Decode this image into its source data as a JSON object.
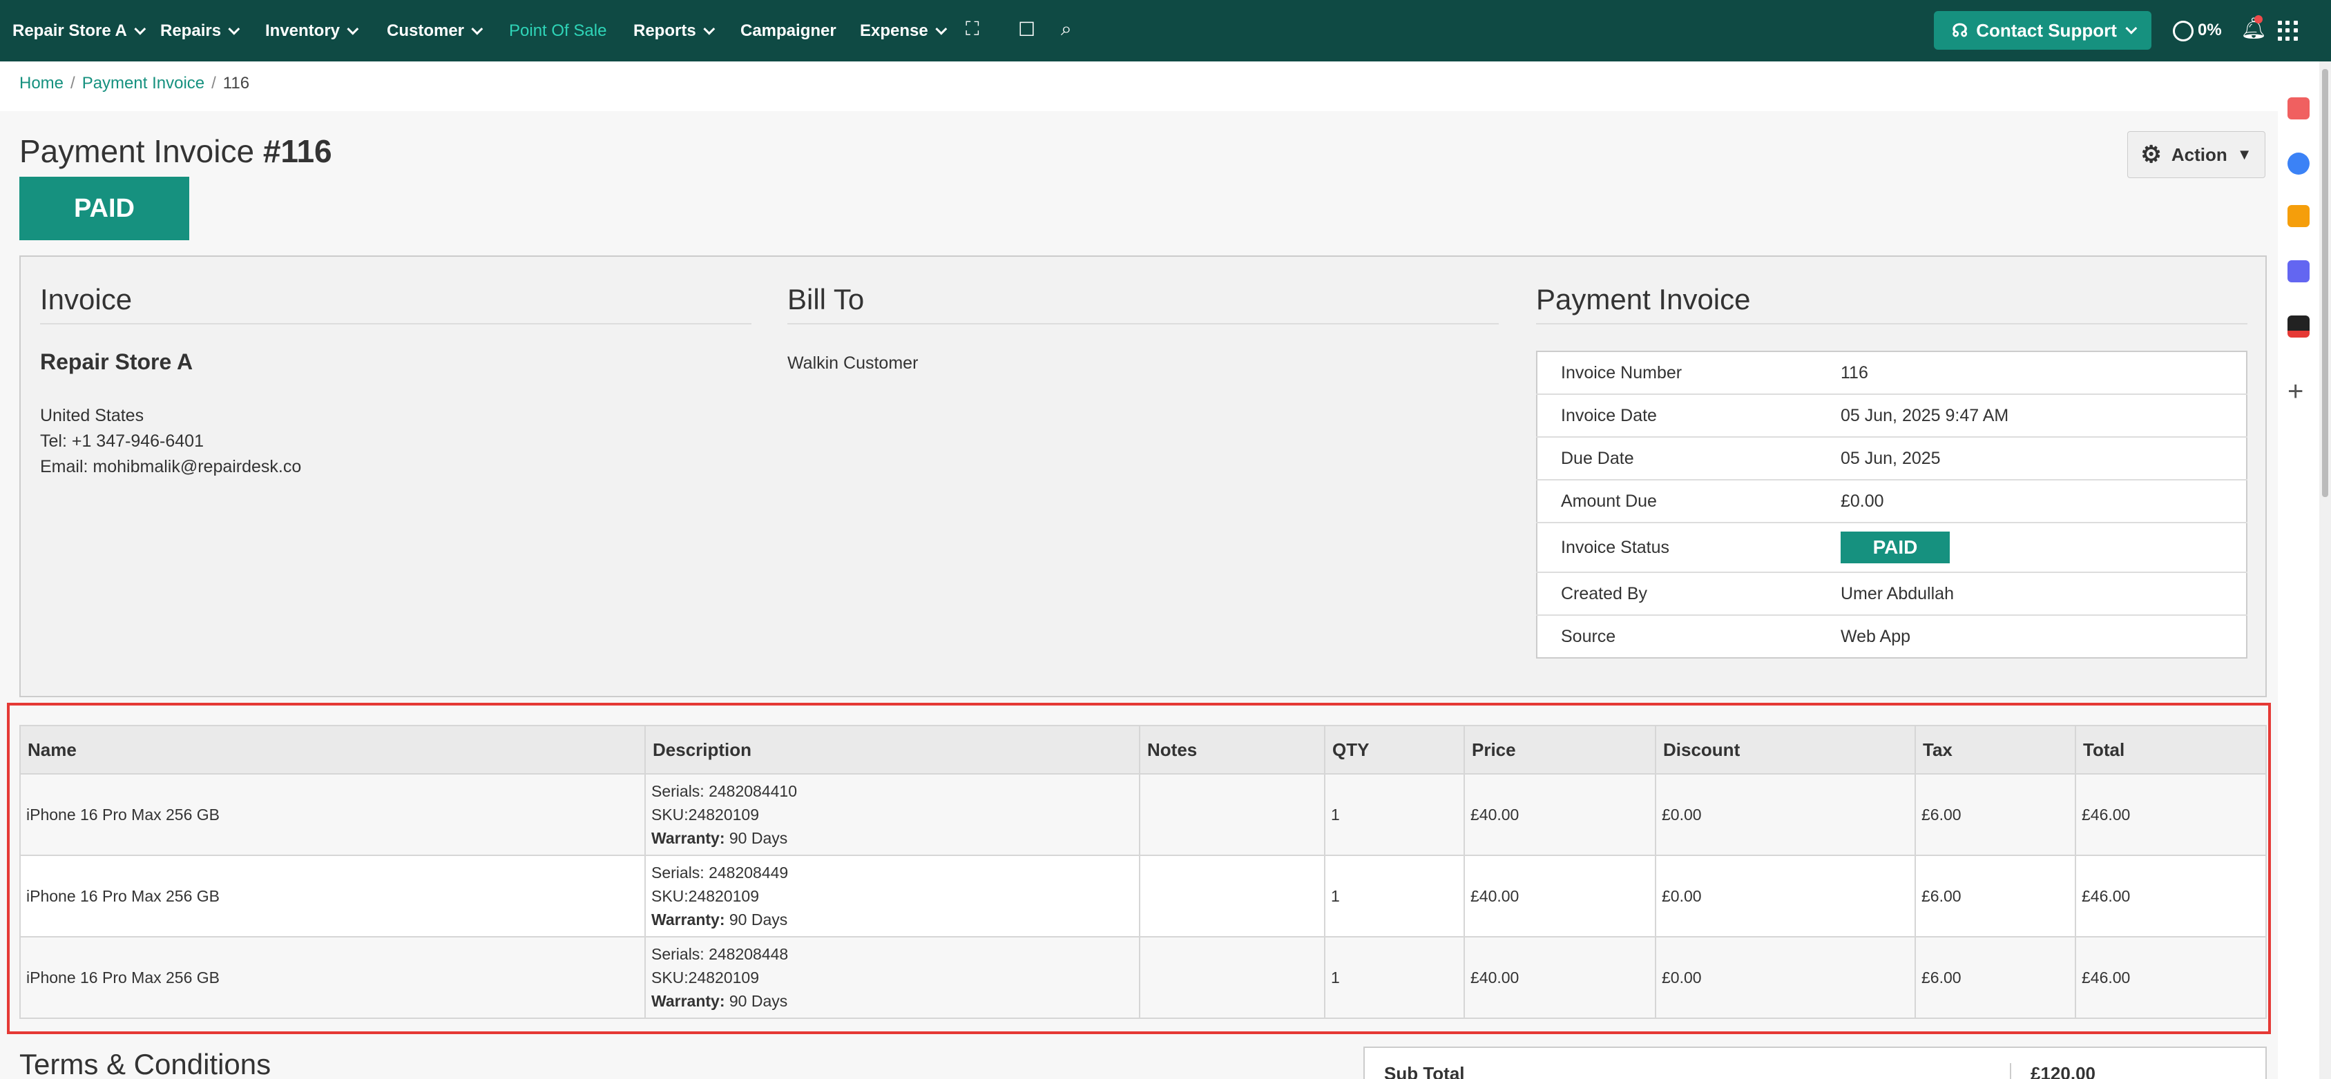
{
  "nav": {
    "store": "Repair Store A",
    "items": [
      "Repairs",
      "Inventory",
      "Customer",
      "Point Of Sale",
      "Reports",
      "Campaigner",
      "Expense"
    ],
    "support_label": "Contact Support",
    "progress": "0%"
  },
  "breadcrumb": {
    "home": "Home",
    "section": "Payment Invoice",
    "current": "116"
  },
  "title": {
    "prefix": "Payment Invoice",
    "number": "#116"
  },
  "status_badge": "PAID",
  "action_label": "Action",
  "invoice": {
    "heading": "Invoice",
    "store_name": "Repair Store A",
    "country": "United States",
    "tel": "Tel: +1 347-946-6401",
    "email": "Email: mohibmalik@repairdesk.co"
  },
  "bill_to": {
    "heading": "Bill To",
    "name": "Walkin Customer"
  },
  "payment_invoice": {
    "heading": "Payment Invoice",
    "rows": [
      {
        "label": "Invoice Number",
        "value": "116"
      },
      {
        "label": "Invoice Date",
        "value": "05 Jun, 2025 9:47 AM"
      },
      {
        "label": "Due Date",
        "value": "05 Jun, 2025"
      },
      {
        "label": "Amount Due",
        "value": "£0.00"
      },
      {
        "label": "Invoice Status",
        "value": "PAID"
      },
      {
        "label": "Created By",
        "value": "Umer Abdullah"
      },
      {
        "label": "Source",
        "value": "Web App"
      }
    ]
  },
  "items": {
    "headers": [
      "Name",
      "Description",
      "Notes",
      "QTY",
      "Price",
      "Discount",
      "Tax",
      "Total"
    ],
    "warranty_label": "Warranty:",
    "rows": [
      {
        "name": "iPhone 16 Pro Max 256 GB",
        "serials": "Serials: 2482084410",
        "sku": "SKU:24820109",
        "warranty": "90 Days",
        "notes": "",
        "qty": "1",
        "price": "£40.00",
        "discount": "£0.00",
        "tax": "£6.00",
        "total": "£46.00"
      },
      {
        "name": "iPhone 16 Pro Max 256 GB",
        "serials": "Serials: 248208449",
        "sku": "SKU:24820109",
        "warranty": "90 Days",
        "notes": "",
        "qty": "1",
        "price": "£40.00",
        "discount": "£0.00",
        "tax": "£6.00",
        "total": "£46.00"
      },
      {
        "name": "iPhone 16 Pro Max 256 GB",
        "serials": "Serials: 248208448",
        "sku": "SKU:24820109",
        "warranty": "90 Days",
        "notes": "",
        "qty": "1",
        "price": "£40.00",
        "discount": "£0.00",
        "tax": "£6.00",
        "total": "£46.00"
      }
    ]
  },
  "terms_heading": "Terms & Conditions",
  "totals": {
    "sub_total_label": "Sub Total",
    "sub_total_value": "£120.00"
  },
  "colors": {
    "nav_bg": "#0f4a44",
    "accent": "#16917f",
    "highlight": "#e53935"
  }
}
